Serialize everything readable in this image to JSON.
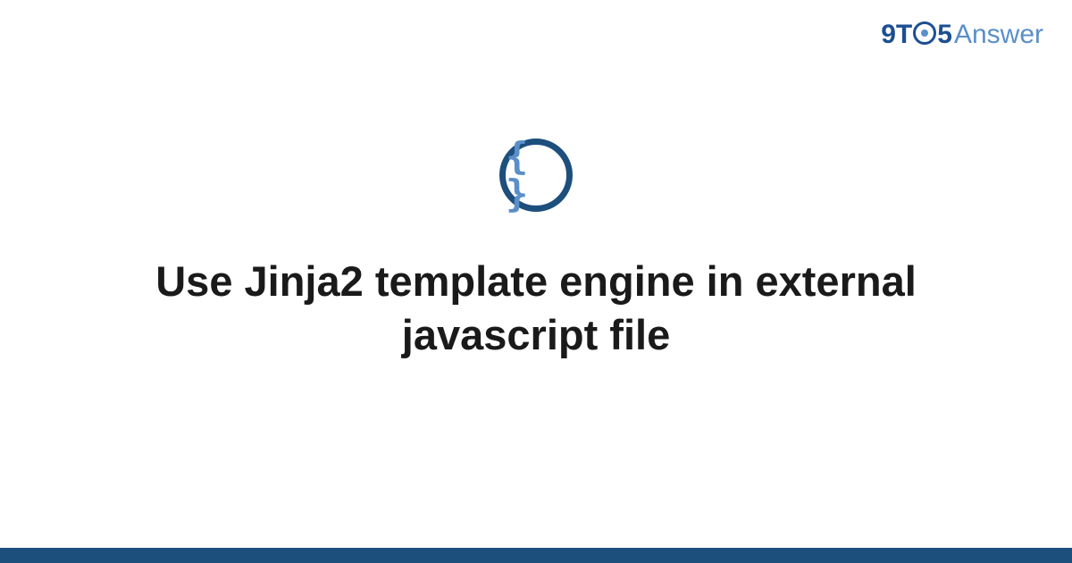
{
  "header": {
    "logo_prefix": "9T",
    "logo_suffix": "5",
    "logo_word": "Answer"
  },
  "icon": {
    "braces": "{ }"
  },
  "main": {
    "title": "Use Jinja2 template engine in external javascript file"
  }
}
